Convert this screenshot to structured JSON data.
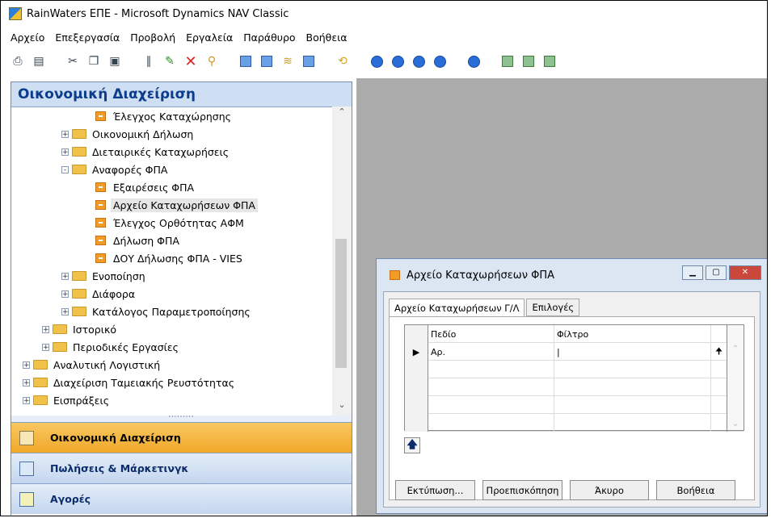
{
  "window": {
    "title": "RainWaters ΕΠΕ - Microsoft Dynamics NAV Classic"
  },
  "menu": {
    "items": [
      "Αρχείο",
      "Επεξεργασία",
      "Προβολή",
      "Εργαλεία",
      "Παράθυρο",
      "Βοήθεια"
    ]
  },
  "toolbar": {
    "icons": [
      "print-icon",
      "preview-icon",
      "cut-icon",
      "copy-icon",
      "paste-icon",
      "attach-icon",
      "new-icon",
      "delete-icon",
      "find-icon",
      "filter-icon",
      "flowfilter-icon",
      "sort-icon",
      "table-icon",
      "refresh-icon",
      "first-icon",
      "previous-icon",
      "next-icon",
      "last-icon",
      "up-icon",
      "card-icon",
      "list-icon",
      "lookup-icon"
    ]
  },
  "navigation": {
    "header": "Οικονομική Διαχείριση",
    "tree": [
      {
        "label": "Έλεγχος Καταχώρησης",
        "type": "report"
      },
      {
        "label": "Οικονομική Δήλωση",
        "type": "folder",
        "expander": "+"
      },
      {
        "label": "Διεταιρικές Καταχωρήσεις",
        "type": "folder",
        "expander": "+"
      },
      {
        "label": "Αναφορές ΦΠΑ",
        "type": "folder-open",
        "expander": "-"
      },
      {
        "label": "Εξαιρέσεις ΦΠΑ",
        "type": "report"
      },
      {
        "label": "Αρχείο Καταχωρήσεων ΦΠΑ",
        "type": "report",
        "selected": true
      },
      {
        "label": "Έλεγχος Ορθότητας ΑΦΜ",
        "type": "report"
      },
      {
        "label": "Δήλωση ΦΠΑ",
        "type": "report"
      },
      {
        "label": "ΔΟΥ Δήλωσης ΦΠΑ - VIES",
        "type": "report"
      },
      {
        "label": "Ενοποίηση",
        "type": "folder",
        "expander": "+"
      },
      {
        "label": "Διάφορα",
        "type": "folder",
        "expander": "+"
      },
      {
        "label": "Κατάλογος Παραμετροποίησης",
        "type": "folder",
        "expander": "+"
      },
      {
        "label": "Ιστορικό",
        "type": "folder",
        "expander": "+"
      },
      {
        "label": "Περιοδικές Εργασίες",
        "type": "folder",
        "expander": "+"
      },
      {
        "label": "Αναλυτική Λογιστική",
        "type": "folder",
        "expander": "+"
      },
      {
        "label": "Διαχείριση Ταμειακής Ρευστότητας",
        "type": "folder",
        "expander": "+"
      },
      {
        "label": "Εισπράξεις",
        "type": "folder",
        "expander": "+"
      }
    ],
    "grip": "·········",
    "buttons": [
      {
        "label": "Οικονομική Διαχείριση",
        "active": true
      },
      {
        "label": "Πωλήσεις & Μάρκετινγκ",
        "active": false
      },
      {
        "label": "Αγορές",
        "active": false
      }
    ]
  },
  "dialog": {
    "title": "Αρχείο Καταχωρήσεων ΦΠΑ",
    "tabs": [
      "Αρχείο Καταχωρήσεων Γ/Λ",
      "Επιλογές"
    ],
    "grid": {
      "columns": [
        "Πεδίο",
        "Φίλτρο"
      ],
      "rows": [
        {
          "field": "Αρ.",
          "filter": "|"
        },
        {
          "field": "",
          "filter": ""
        },
        {
          "field": "",
          "filter": ""
        },
        {
          "field": "",
          "filter": ""
        },
        {
          "field": "",
          "filter": ""
        }
      ]
    },
    "buttons": {
      "print": "Εκτύπωση...",
      "preview": "Προεπισκόπηση",
      "cancel": "Άκυρο",
      "help": "Βοήθεια"
    }
  }
}
